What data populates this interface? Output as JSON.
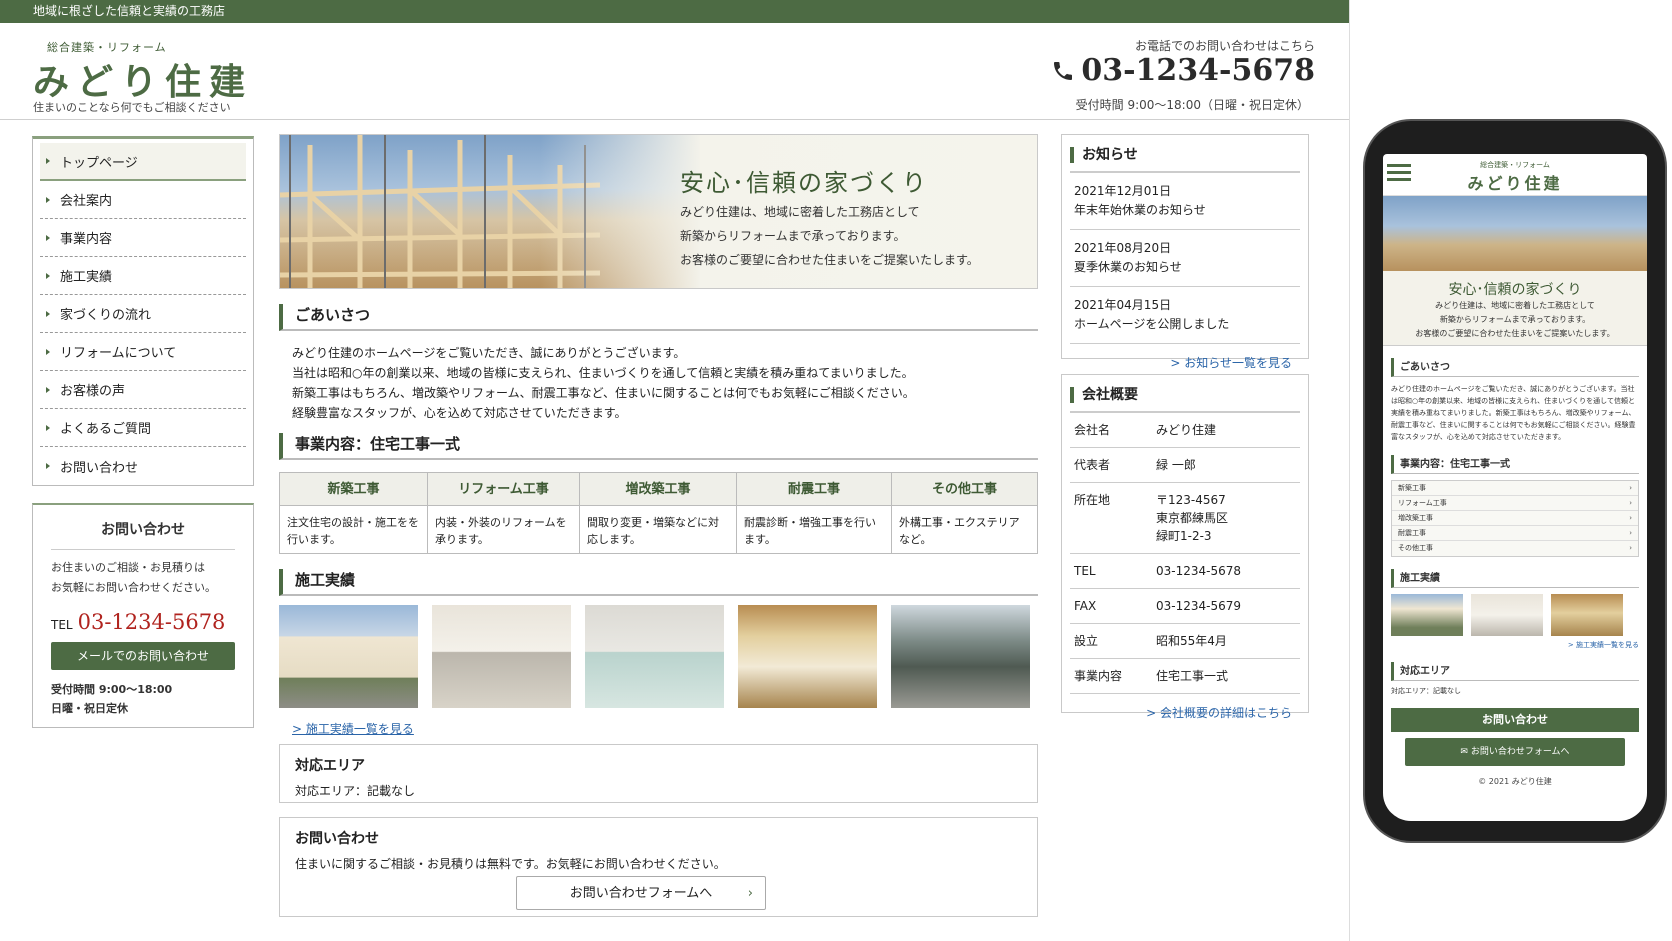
{
  "topbar": {
    "text": "地域に根ざした信頼と実績の工務店"
  },
  "header": {
    "logo_sub": "総合建築・リフォーム",
    "logo_name": "みどり住建",
    "tagline": "住まいのことなら何でもご相談ください",
    "tel_caption": "お電話でのお問い合わせはこちら",
    "tel": "03-1234-5678",
    "hours": "受付時間 9:00〜18:00（日曜・祝日定休）"
  },
  "nav": [
    "トップページ",
    "会社案内",
    "事業内容",
    "施工実績",
    "家づくりの流れ",
    "リフォームについて",
    "お客様の声",
    "よくあるご質問",
    "お問い合わせ"
  ],
  "side_contact": {
    "title": "お問い合わせ",
    "text1": "お住まいのご相談・お見積りは",
    "text2": "お気軽にお問い合わせください。",
    "tel_label": "TEL",
    "tel": "03-1234-5678",
    "mail_button": "メールでのお問い合わせ",
    "hours1": "受付時間 9:00〜18:00",
    "hours2": "日曜・祝日定休"
  },
  "hero": {
    "title": "安心･信頼の家づくり",
    "line1": "みどり住建は、地域に密着した工務店として",
    "line2": "新築からリフォームまで承っております。",
    "line3": "お客様のご要望に合わせた住まいをご提案いたします。"
  },
  "greeting": {
    "heading": "ごあいさつ",
    "lines": [
      "みどり住建のホームページをご覧いただき、誠にありがとうございます。",
      "当社は昭和○年の創業以来、地域の皆様に支えられ、住まいづくりを通して信頼と実績を積み重ねてまいりました。",
      "新築工事はもちろん、増改築やリフォーム、耐震工事など、住まいに関することは何でもお気軽にご相談ください。",
      "経験豊富なスタッフが、心を込めて対応させていただきます。"
    ]
  },
  "services": {
    "heading": "事業内容：住宅工事一式",
    "items": [
      {
        "name": "新築工事",
        "desc": "注文住宅の設計・施工をを行います。"
      },
      {
        "name": "リフォーム工事",
        "desc": "内装・外装のリフォームを承ります。"
      },
      {
        "name": "増改築工事",
        "desc": "間取り変更・増築などに対応します。"
      },
      {
        "name": "耐震工事",
        "desc": "耐震診断・増強工事を行います。"
      },
      {
        "name": "その他工事",
        "desc": "外構工事・エクステリアなど。"
      }
    ]
  },
  "works": {
    "heading": "施工実績",
    "link": "> 施工実績一覧を見る"
  },
  "area": {
    "heading": "対応エリア",
    "text": "対応エリア：記載なし"
  },
  "contact_box": {
    "heading": "お問い合わせ",
    "text": "住まいに関するご相談・お見積りは無料です。お気軽にお問い合わせください。",
    "button": "お問い合わせフォームへ",
    "chevron": "›"
  },
  "news": {
    "heading": "お知らせ",
    "items": [
      {
        "date": "2021年12月01日",
        "title": "年末年始休業のお知らせ"
      },
      {
        "date": "2021年08月20日",
        "title": "夏季休業のお知らせ"
      },
      {
        "date": "2021年04月15日",
        "title": "ホームページを公開しました"
      }
    ],
    "link": "> お知らせ一覧を見る"
  },
  "company": {
    "heading": "会社概要",
    "rows": [
      {
        "k": "会社名",
        "v": "みどり住建"
      },
      {
        "k": "代表者",
        "v": "緑 一郎"
      },
      {
        "k": "所在地",
        "v": "〒123-4567\n東京都練馬区\n緑町1-2-3"
      },
      {
        "k": "TEL",
        "v": "03-1234-5678"
      },
      {
        "k": "FAX",
        "v": "03-1234-5679"
      },
      {
        "k": "設立",
        "v": "昭和55年4月"
      },
      {
        "k": "事業内容",
        "v": "住宅工事一式"
      }
    ],
    "link": "> 会社概要の詳細はこちら"
  },
  "mobile": {
    "logo_sub": "総合建築・リフォーム",
    "logo_name": "みどり住建",
    "hero_title": "安心･信頼の家づくり",
    "hero_l1": "みどり住建は、地域に密着した工務店として",
    "hero_l2": "新築からリフォームまで承っております。",
    "hero_l3": "お客様のご要望に合わせた住まいをご提案いたします。",
    "greet_h": "ごあいさつ",
    "greet_t": "みどり住建のホームページをご覧いただき、誠にありがとうございます。当社は昭和○年の創業以来、地域の皆様に支えられ、住まいづくりを通して信頼と実績を積み重ねてまいりました。新築工事はもちろん、増改築やリフォーム、耐震工事など、住まいに関することは何でもお気軽にご相談ください。経験豊富なスタッフが、心を込めて対応させていただきます。",
    "svc_h": "事業内容：住宅工事一式",
    "svc": [
      "新築工事",
      "リフォーム工事",
      "増改築工事",
      "耐震工事",
      "その他工事"
    ],
    "chevron": "›",
    "works_h": "施工実績",
    "works_link": "> 施工実績一覧を見る",
    "area_h": "対応エリア",
    "area_t": "対応エリア：記載なし",
    "contact_bar": "お問い合わせ",
    "contact_btn": "お問い合わせフォームへ",
    "copyright": "© 2021 みどり住建"
  }
}
